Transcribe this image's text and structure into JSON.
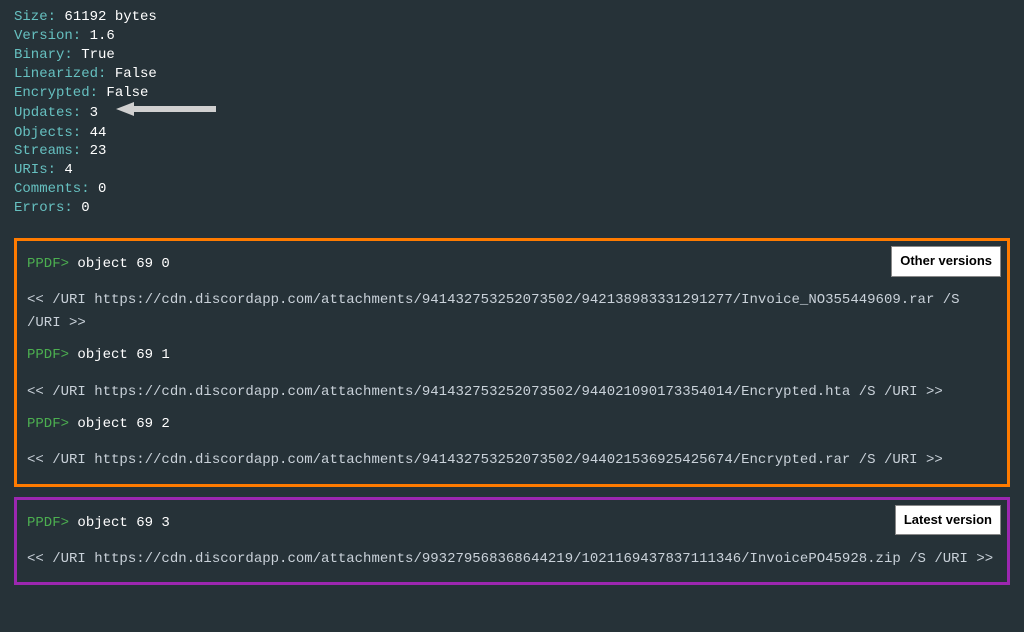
{
  "info": [
    {
      "key": "Size:",
      "value": " 61192 bytes"
    },
    {
      "key": "Version:",
      "value": " 1.6"
    },
    {
      "key": "Binary:",
      "value": " True"
    },
    {
      "key": "Linearized:",
      "value": " False"
    },
    {
      "key": "Encrypted:",
      "value": " False"
    },
    {
      "key": "Updates:",
      "value": " 3",
      "arrow": true
    },
    {
      "key": "Objects:",
      "value": " 44"
    },
    {
      "key": "Streams:",
      "value": " 23"
    },
    {
      "key": "URIs:",
      "value": " 4"
    },
    {
      "key": "Comments:",
      "value": " 0"
    },
    {
      "key": "Errors:",
      "value": " 0"
    }
  ],
  "prompt": "PPDF>",
  "boxes": {
    "other": {
      "label": "Other versions",
      "entries": [
        {
          "cmd": " object 69 0",
          "out": "<< /URI https://cdn.discordapp.com/attachments/941432753252073502/942138983331291277/Invoice_NO355449609.rar /S /URI >>"
        },
        {
          "cmd": " object 69 1",
          "out": "<< /URI https://cdn.discordapp.com/attachments/941432753252073502/944021090173354014/Encrypted.hta /S /URI >>"
        },
        {
          "cmd": " object 69 2",
          "out": "<< /URI https://cdn.discordapp.com/attachments/941432753252073502/944021536925425674/Encrypted.rar /S /URI >>"
        }
      ]
    },
    "latest": {
      "label": "Latest version",
      "entries": [
        {
          "cmd": " object 69 3",
          "out": "<< /URI https://cdn.discordapp.com/attachments/993279568368644219/1021169437837111346/InvoicePO45928.zip /S /URI >>"
        }
      ]
    }
  }
}
